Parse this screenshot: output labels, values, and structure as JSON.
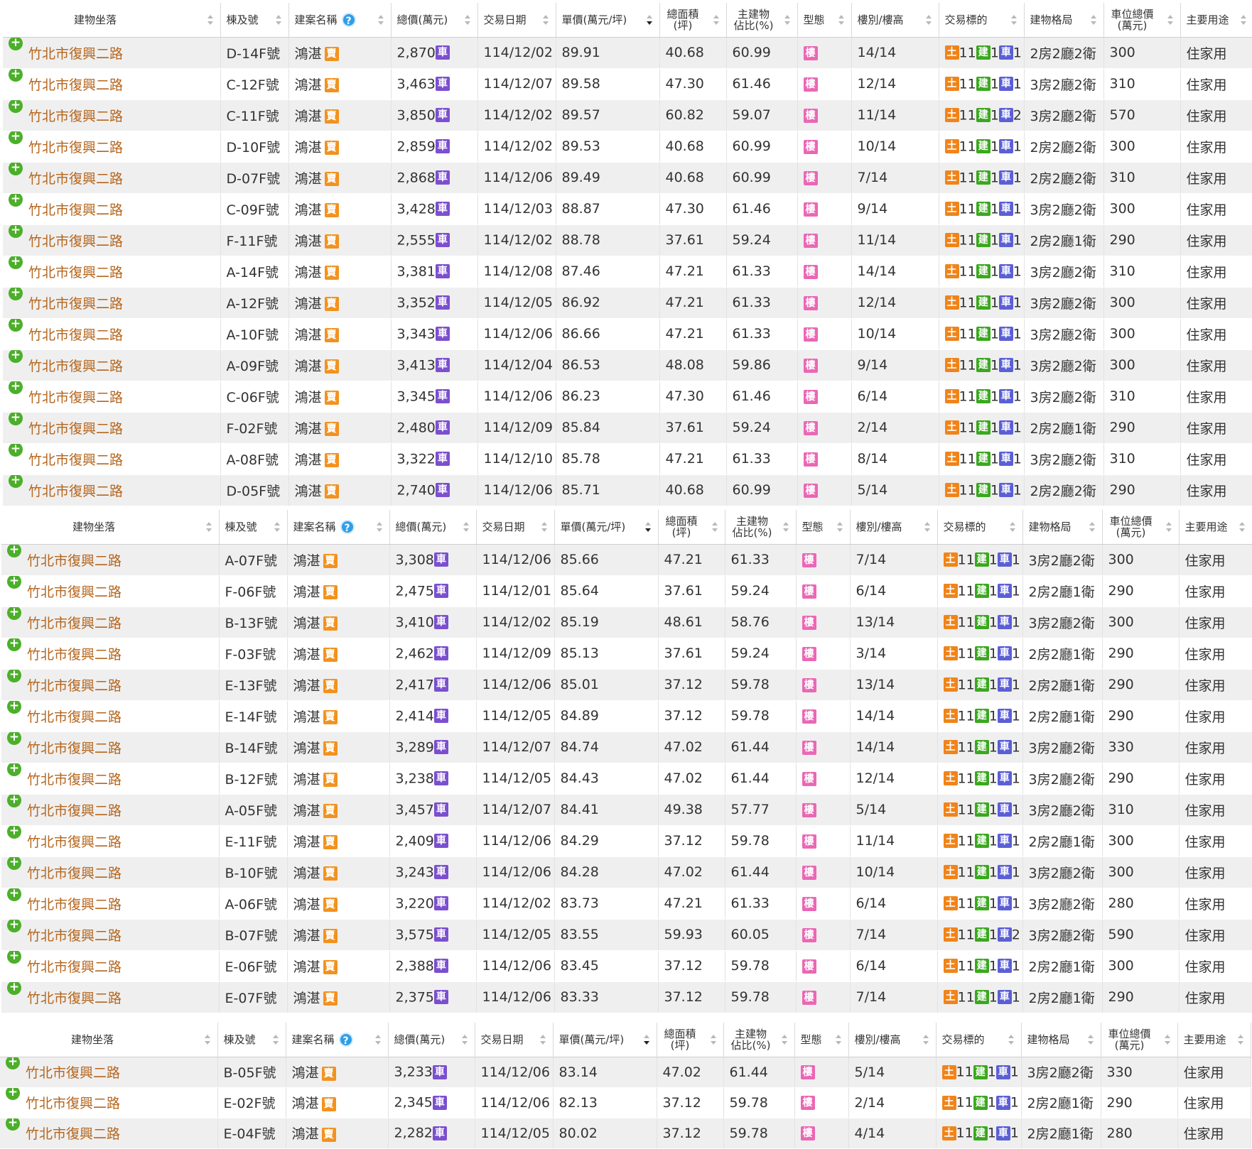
{
  "headers": {
    "address": "建物坐落",
    "unit": "棟及號",
    "project": "建案名稱",
    "total": "總價(萬元)",
    "date": "交易日期",
    "unit_price": "單價(萬元/坪)",
    "area_l1": "總面積",
    "area_l2": "(坪)",
    "main_l1": "主建物",
    "main_l2": "佔比(%)",
    "type": "型態",
    "floor": "樓別/樓高",
    "target": "交易標的",
    "layout": "建物格局",
    "park_l1": "車位總價",
    "park_l2": "(萬元)",
    "use": "主要用途"
  },
  "icons": {
    "expand": "plus-circle-icon",
    "help": "question-icon",
    "help_glyph": "?",
    "plus_glyph": "+"
  },
  "tags": {
    "car": "車",
    "sale": "賣",
    "building_type": "樓",
    "land": "土",
    "building": "建",
    "parking": "車"
  },
  "colors": {
    "address": "#b5651d",
    "expand_icon": "#4caf2a",
    "help_icon": "#2e9ee8",
    "tag_car": "#7b4fcf",
    "tag_sale": "#f2921e",
    "tag_building_type": "#ea67b5",
    "tag_land": "#f0841a",
    "tag_building": "#3aa81e",
    "tag_parking": "#5b5fd6",
    "row_alt": "#efefef"
  },
  "sections": [
    {
      "rows": [
        {
          "address": "竹北市復興二路",
          "unit": "D-14F號",
          "project": "鴻湛",
          "total": "2,870",
          "date": "114/12/02",
          "unit_price": "89.91",
          "area": "40.68",
          "main_ratio": "60.99",
          "floor": "14/14",
          "land": "11",
          "bldg": "1",
          "park": "1",
          "layout": "2房2廳2衛",
          "park_price": "300",
          "use": "住家用"
        },
        {
          "address": "竹北市復興二路",
          "unit": "C-12F號",
          "project": "鴻湛",
          "total": "3,463",
          "date": "114/12/07",
          "unit_price": "89.58",
          "area": "47.30",
          "main_ratio": "61.46",
          "floor": "12/14",
          "land": "11",
          "bldg": "1",
          "park": "1",
          "layout": "3房2廳2衛",
          "park_price": "310",
          "use": "住家用"
        },
        {
          "address": "竹北市復興二路",
          "unit": "C-11F號",
          "project": "鴻湛",
          "total": "3,850",
          "date": "114/12/02",
          "unit_price": "89.57",
          "area": "60.82",
          "main_ratio": "59.07",
          "floor": "11/14",
          "land": "11",
          "bldg": "1",
          "park": "2",
          "layout": "3房2廳2衛",
          "park_price": "570",
          "use": "住家用"
        },
        {
          "address": "竹北市復興二路",
          "unit": "D-10F號",
          "project": "鴻湛",
          "total": "2,859",
          "date": "114/12/02",
          "unit_price": "89.53",
          "area": "40.68",
          "main_ratio": "60.99",
          "floor": "10/14",
          "land": "11",
          "bldg": "1",
          "park": "1",
          "layout": "2房2廳2衛",
          "park_price": "300",
          "use": "住家用"
        },
        {
          "address": "竹北市復興二路",
          "unit": "D-07F號",
          "project": "鴻湛",
          "total": "2,868",
          "date": "114/12/06",
          "unit_price": "89.49",
          "area": "40.68",
          "main_ratio": "60.99",
          "floor": "7/14",
          "land": "11",
          "bldg": "1",
          "park": "1",
          "layout": "2房2廳2衛",
          "park_price": "310",
          "use": "住家用"
        },
        {
          "address": "竹北市復興二路",
          "unit": "C-09F號",
          "project": "鴻湛",
          "total": "3,428",
          "date": "114/12/03",
          "unit_price": "88.87",
          "area": "47.30",
          "main_ratio": "61.46",
          "floor": "9/14",
          "land": "11",
          "bldg": "1",
          "park": "1",
          "layout": "3房2廳2衛",
          "park_price": "300",
          "use": "住家用"
        },
        {
          "address": "竹北市復興二路",
          "unit": "F-11F號",
          "project": "鴻湛",
          "total": "2,555",
          "date": "114/12/02",
          "unit_price": "88.78",
          "area": "37.61",
          "main_ratio": "59.24",
          "floor": "11/14",
          "land": "11",
          "bldg": "1",
          "park": "1",
          "layout": "2房2廳1衛",
          "park_price": "290",
          "use": "住家用"
        },
        {
          "address": "竹北市復興二路",
          "unit": "A-14F號",
          "project": "鴻湛",
          "total": "3,381",
          "date": "114/12/08",
          "unit_price": "87.46",
          "area": "47.21",
          "main_ratio": "61.33",
          "floor": "14/14",
          "land": "11",
          "bldg": "1",
          "park": "1",
          "layout": "3房2廳2衛",
          "park_price": "310",
          "use": "住家用"
        },
        {
          "address": "竹北市復興二路",
          "unit": "A-12F號",
          "project": "鴻湛",
          "total": "3,352",
          "date": "114/12/05",
          "unit_price": "86.92",
          "area": "47.21",
          "main_ratio": "61.33",
          "floor": "12/14",
          "land": "11",
          "bldg": "1",
          "park": "1",
          "layout": "3房2廳2衛",
          "park_price": "300",
          "use": "住家用"
        },
        {
          "address": "竹北市復興二路",
          "unit": "A-10F號",
          "project": "鴻湛",
          "total": "3,343",
          "date": "114/12/06",
          "unit_price": "86.66",
          "area": "47.21",
          "main_ratio": "61.33",
          "floor": "10/14",
          "land": "11",
          "bldg": "1",
          "park": "1",
          "layout": "3房2廳2衛",
          "park_price": "300",
          "use": "住家用"
        },
        {
          "address": "竹北市復興二路",
          "unit": "A-09F號",
          "project": "鴻湛",
          "total": "3,413",
          "date": "114/12/04",
          "unit_price": "86.53",
          "area": "48.08",
          "main_ratio": "59.86",
          "floor": "9/14",
          "land": "11",
          "bldg": "1",
          "park": "1",
          "layout": "3房2廳2衛",
          "park_price": "300",
          "use": "住家用"
        },
        {
          "address": "竹北市復興二路",
          "unit": "C-06F號",
          "project": "鴻湛",
          "total": "3,345",
          "date": "114/12/06",
          "unit_price": "86.23",
          "area": "47.30",
          "main_ratio": "61.46",
          "floor": "6/14",
          "land": "11",
          "bldg": "1",
          "park": "1",
          "layout": "3房2廳2衛",
          "park_price": "310",
          "use": "住家用"
        },
        {
          "address": "竹北市復興二路",
          "unit": "F-02F號",
          "project": "鴻湛",
          "total": "2,480",
          "date": "114/12/09",
          "unit_price": "85.84",
          "area": "37.61",
          "main_ratio": "59.24",
          "floor": "2/14",
          "land": "11",
          "bldg": "1",
          "park": "1",
          "layout": "2房2廳1衛",
          "park_price": "290",
          "use": "住家用"
        },
        {
          "address": "竹北市復興二路",
          "unit": "A-08F號",
          "project": "鴻湛",
          "total": "3,322",
          "date": "114/12/10",
          "unit_price": "85.78",
          "area": "47.21",
          "main_ratio": "61.33",
          "floor": "8/14",
          "land": "11",
          "bldg": "1",
          "park": "1",
          "layout": "3房2廳2衛",
          "park_price": "310",
          "use": "住家用"
        },
        {
          "address": "竹北市復興二路",
          "unit": "D-05F號",
          "project": "鴻湛",
          "total": "2,740",
          "date": "114/12/06",
          "unit_price": "85.71",
          "area": "40.68",
          "main_ratio": "60.99",
          "floor": "5/14",
          "land": "11",
          "bldg": "1",
          "park": "1",
          "layout": "2房2廳2衛",
          "park_price": "290",
          "use": "住家用"
        }
      ]
    },
    {
      "rows": [
        {
          "address": "竹北市復興二路",
          "unit": "A-07F號",
          "project": "鴻湛",
          "total": "3,308",
          "date": "114/12/06",
          "unit_price": "85.66",
          "area": "47.21",
          "main_ratio": "61.33",
          "floor": "7/14",
          "land": "11",
          "bldg": "1",
          "park": "1",
          "layout": "3房2廳2衛",
          "park_price": "300",
          "use": "住家用"
        },
        {
          "address": "竹北市復興二路",
          "unit": "F-06F號",
          "project": "鴻湛",
          "total": "2,475",
          "date": "114/12/01",
          "unit_price": "85.64",
          "area": "37.61",
          "main_ratio": "59.24",
          "floor": "6/14",
          "land": "11",
          "bldg": "1",
          "park": "1",
          "layout": "2房2廳1衛",
          "park_price": "290",
          "use": "住家用"
        },
        {
          "address": "竹北市復興二路",
          "unit": "B-13F號",
          "project": "鴻湛",
          "total": "3,410",
          "date": "114/12/02",
          "unit_price": "85.19",
          "area": "48.61",
          "main_ratio": "58.76",
          "floor": "13/14",
          "land": "11",
          "bldg": "1",
          "park": "1",
          "layout": "3房2廳2衛",
          "park_price": "300",
          "use": "住家用"
        },
        {
          "address": "竹北市復興二路",
          "unit": "F-03F號",
          "project": "鴻湛",
          "total": "2,462",
          "date": "114/12/09",
          "unit_price": "85.13",
          "area": "37.61",
          "main_ratio": "59.24",
          "floor": "3/14",
          "land": "11",
          "bldg": "1",
          "park": "1",
          "layout": "2房2廳1衛",
          "park_price": "290",
          "use": "住家用"
        },
        {
          "address": "竹北市復興二路",
          "unit": "E-13F號",
          "project": "鴻湛",
          "total": "2,417",
          "date": "114/12/06",
          "unit_price": "85.01",
          "area": "37.12",
          "main_ratio": "59.78",
          "floor": "13/14",
          "land": "11",
          "bldg": "1",
          "park": "1",
          "layout": "2房2廳1衛",
          "park_price": "290",
          "use": "住家用"
        },
        {
          "address": "竹北市復興二路",
          "unit": "E-14F號",
          "project": "鴻湛",
          "total": "2,414",
          "date": "114/12/05",
          "unit_price": "84.89",
          "area": "37.12",
          "main_ratio": "59.78",
          "floor": "14/14",
          "land": "11",
          "bldg": "1",
          "park": "1",
          "layout": "2房2廳1衛",
          "park_price": "290",
          "use": "住家用"
        },
        {
          "address": "竹北市復興二路",
          "unit": "B-14F號",
          "project": "鴻湛",
          "total": "3,289",
          "date": "114/12/07",
          "unit_price": "84.74",
          "area": "47.02",
          "main_ratio": "61.44",
          "floor": "14/14",
          "land": "11",
          "bldg": "1",
          "park": "1",
          "layout": "3房2廳2衛",
          "park_price": "330",
          "use": "住家用"
        },
        {
          "address": "竹北市復興二路",
          "unit": "B-12F號",
          "project": "鴻湛",
          "total": "3,238",
          "date": "114/12/05",
          "unit_price": "84.43",
          "area": "47.02",
          "main_ratio": "61.44",
          "floor": "12/14",
          "land": "11",
          "bldg": "1",
          "park": "1",
          "layout": "3房2廳2衛",
          "park_price": "290",
          "use": "住家用"
        },
        {
          "address": "竹北市復興二路",
          "unit": "A-05F號",
          "project": "鴻湛",
          "total": "3,457",
          "date": "114/12/07",
          "unit_price": "84.41",
          "area": "49.38",
          "main_ratio": "57.77",
          "floor": "5/14",
          "land": "11",
          "bldg": "1",
          "park": "1",
          "layout": "3房2廳2衛",
          "park_price": "310",
          "use": "住家用"
        },
        {
          "address": "竹北市復興二路",
          "unit": "E-11F號",
          "project": "鴻湛",
          "total": "2,409",
          "date": "114/12/06",
          "unit_price": "84.29",
          "area": "37.12",
          "main_ratio": "59.78",
          "floor": "11/14",
          "land": "11",
          "bldg": "1",
          "park": "1",
          "layout": "2房2廳1衛",
          "park_price": "300",
          "use": "住家用"
        },
        {
          "address": "竹北市復興二路",
          "unit": "B-10F號",
          "project": "鴻湛",
          "total": "3,243",
          "date": "114/12/06",
          "unit_price": "84.28",
          "area": "47.02",
          "main_ratio": "61.44",
          "floor": "10/14",
          "land": "11",
          "bldg": "1",
          "park": "1",
          "layout": "3房2廳2衛",
          "park_price": "300",
          "use": "住家用"
        },
        {
          "address": "竹北市復興二路",
          "unit": "A-06F號",
          "project": "鴻湛",
          "total": "3,220",
          "date": "114/12/02",
          "unit_price": "83.73",
          "area": "47.21",
          "main_ratio": "61.33",
          "floor": "6/14",
          "land": "11",
          "bldg": "1",
          "park": "1",
          "layout": "3房2廳2衛",
          "park_price": "280",
          "use": "住家用"
        },
        {
          "address": "竹北市復興二路",
          "unit": "B-07F號",
          "project": "鴻湛",
          "total": "3,575",
          "date": "114/12/05",
          "unit_price": "83.55",
          "area": "59.93",
          "main_ratio": "60.05",
          "floor": "7/14",
          "land": "11",
          "bldg": "1",
          "park": "2",
          "layout": "3房2廳2衛",
          "park_price": "590",
          "use": "住家用"
        },
        {
          "address": "竹北市復興二路",
          "unit": "E-06F號",
          "project": "鴻湛",
          "total": "2,388",
          "date": "114/12/06",
          "unit_price": "83.45",
          "area": "37.12",
          "main_ratio": "59.78",
          "floor": "6/14",
          "land": "11",
          "bldg": "1",
          "park": "1",
          "layout": "2房2廳1衛",
          "park_price": "300",
          "use": "住家用"
        },
        {
          "address": "竹北市復興二路",
          "unit": "E-07F號",
          "project": "鴻湛",
          "total": "2,375",
          "date": "114/12/06",
          "unit_price": "83.33",
          "area": "37.12",
          "main_ratio": "59.78",
          "floor": "7/14",
          "land": "11",
          "bldg": "1",
          "park": "1",
          "layout": "2房2廳1衛",
          "park_price": "290",
          "use": "住家用"
        }
      ]
    },
    {
      "rows": [
        {
          "address": "竹北市復興二路",
          "unit": "B-05F號",
          "project": "鴻湛",
          "total": "3,233",
          "date": "114/12/06",
          "unit_price": "83.14",
          "area": "47.02",
          "main_ratio": "61.44",
          "floor": "5/14",
          "land": "11",
          "bldg": "1",
          "park": "1",
          "layout": "3房2廳2衛",
          "park_price": "330",
          "use": "住家用"
        },
        {
          "address": "竹北市復興二路",
          "unit": "E-02F號",
          "project": "鴻湛",
          "total": "2,345",
          "date": "114/12/06",
          "unit_price": "82.13",
          "area": "37.12",
          "main_ratio": "59.78",
          "floor": "2/14",
          "land": "11",
          "bldg": "1",
          "park": "1",
          "layout": "2房2廳1衛",
          "park_price": "290",
          "use": "住家用"
        },
        {
          "address": "竹北市復興二路",
          "unit": "E-04F號",
          "project": "鴻湛",
          "total": "2,282",
          "date": "114/12/05",
          "unit_price": "80.02",
          "area": "37.12",
          "main_ratio": "59.78",
          "floor": "4/14",
          "land": "11",
          "bldg": "1",
          "park": "1",
          "layout": "2房2廳1衛",
          "park_price": "280",
          "use": "住家用"
        }
      ]
    }
  ]
}
